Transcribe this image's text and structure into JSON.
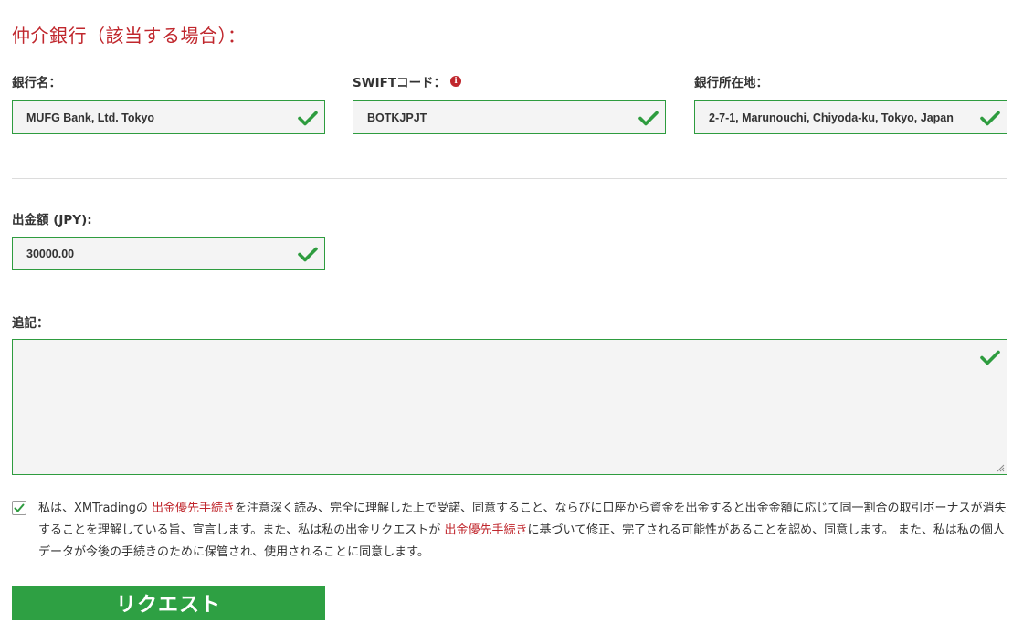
{
  "section": {
    "title": "仲介銀行（該当する場合）："
  },
  "fields": {
    "bank_name": {
      "label": "銀行名：",
      "value": "MUFG Bank, Ltd. Tokyo"
    },
    "swift": {
      "label": "SWIFTコード：",
      "value": "BOTKJPJT",
      "info_icon": "i"
    },
    "bank_address": {
      "label": "銀行所在地：",
      "value": "2-7-1, Marunouchi, Chiyoda-ku, Tokyo, Japan"
    },
    "amount": {
      "label": "出金額 (JPY):",
      "value": "30000.00"
    },
    "memo": {
      "label": "追記：",
      "value": ""
    }
  },
  "agreement": {
    "checked": true,
    "text_1": "私は、XMTradingの ",
    "link_1": "出金優先手続き",
    "text_2": "を注意深く読み、完全に理解した上で受諾、同意すること、ならびに口座から資金を出金すると出金金額に応じて同一割合の取引ボーナスが消失することを理解している旨、宣言します。また、私は私の出金リクエストが ",
    "link_2": "出金優先手続き",
    "text_3": "に基づいて修正、完了される可能性があることを認め、同意します。 また、私は私の個人データが今後の手続きのために保管され、使用されることに同意します。"
  },
  "submit": {
    "label": "リクエスト"
  },
  "colors": {
    "accent_red": "#c0272d",
    "valid_green": "#2e9c3f",
    "button_green": "#2ea043"
  },
  "icons": {
    "valid": "check-icon",
    "info": "info-icon",
    "checkbox": "checkmark-icon"
  }
}
